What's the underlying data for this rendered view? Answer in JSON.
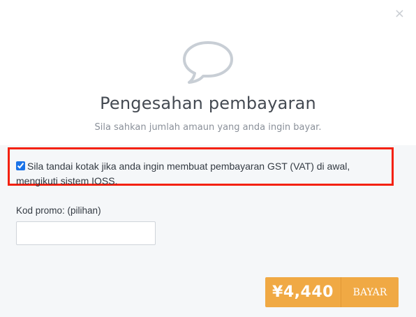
{
  "modal": {
    "close_label": "×",
    "icon": "speech-bubble-icon",
    "title": "Pengesahan pembayaran",
    "subtitle": "Sila sahkan jumlah amaun yang anda ingin bayar."
  },
  "gst": {
    "checked": true,
    "label": "Sila tandai kotak jika anda ingin membuat pembayaran GST (VAT) di awal, mengikuti sistem IOSS.",
    "highlight_color": "#f4210f"
  },
  "promo": {
    "label": "Kod promo: (pilihan)",
    "value": "",
    "placeholder": ""
  },
  "pay_button": {
    "amount": "¥4,440",
    "label": "BAYAR",
    "color": "#f0a944"
  }
}
